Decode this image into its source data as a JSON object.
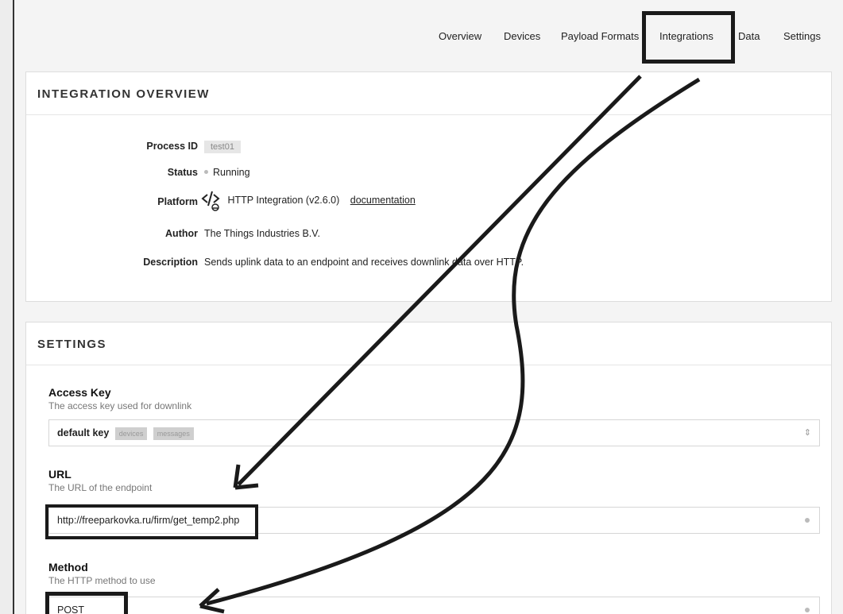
{
  "nav": {
    "tabs": [
      "Overview",
      "Devices",
      "Payload Formats",
      "Integrations",
      "Data",
      "Settings"
    ],
    "active": "Integrations"
  },
  "overview": {
    "title": "INTEGRATION OVERVIEW",
    "process_id_label": "Process ID",
    "process_id": "test01",
    "status_label": "Status",
    "status": "Running",
    "platform_label": "Platform",
    "platform": "HTTP Integration (v2.6.0)",
    "platform_link": "documentation",
    "author_label": "Author",
    "author": "The Things Industries B.V.",
    "description_label": "Description",
    "description": "Sends uplink data to an endpoint and receives downlink data over HTTP."
  },
  "settings": {
    "title": "SETTINGS",
    "access_key": {
      "label": "Access Key",
      "desc": "The access key used for downlink",
      "value": "default key",
      "tags": [
        "devices",
        "messages"
      ]
    },
    "url": {
      "label": "URL",
      "desc": "The URL of the endpoint",
      "value": "http://freeparkovka.ru/firm/get_temp2.php"
    },
    "method": {
      "label": "Method",
      "desc": "The HTTP method to use",
      "value": "POST"
    }
  },
  "colors": {
    "annotation": "#1a1a1a",
    "card": "#ffffff",
    "page": "#f4f4f4"
  }
}
